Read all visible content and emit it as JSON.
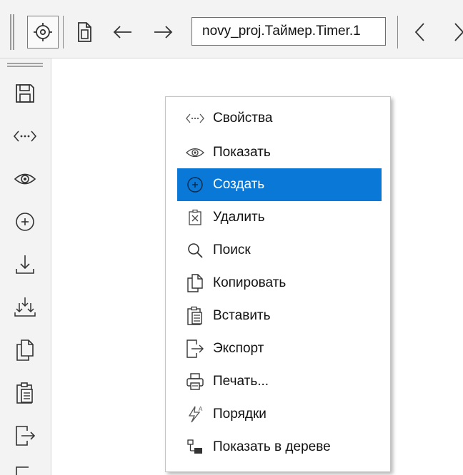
{
  "toolbar": {
    "path_value": "novy_proj.Таймер.Timer.1",
    "buttons": [
      {
        "name": "locate-icon"
      },
      {
        "name": "document-icon"
      },
      {
        "name": "back-arrow-icon"
      },
      {
        "name": "forward-arrow-icon"
      },
      {
        "name": "chevron-left-icon"
      },
      {
        "name": "chevron-right-icon"
      }
    ]
  },
  "left_bar": {
    "buttons": [
      {
        "name": "save-icon"
      },
      {
        "name": "properties-icon"
      },
      {
        "name": "show-icon"
      },
      {
        "name": "create-icon"
      },
      {
        "name": "download-icon"
      },
      {
        "name": "merge-download-icon"
      },
      {
        "name": "copy-icon"
      },
      {
        "name": "paste-icon"
      },
      {
        "name": "export-icon"
      },
      {
        "name": "more-icon"
      }
    ]
  },
  "context_menu": {
    "highlight_color": "#0a78d7",
    "items": [
      {
        "label": "Свойства",
        "icon": "properties-icon"
      },
      {
        "label": "Показать",
        "icon": "eye-icon"
      },
      {
        "label": "Создать",
        "icon": "create-icon",
        "highlighted": true
      },
      {
        "label": "Удалить",
        "icon": "delete-icon"
      },
      {
        "label": "Поиск",
        "icon": "search-icon"
      },
      {
        "label": "Копировать",
        "icon": "copy-icon"
      },
      {
        "label": "Вставить",
        "icon": "paste-icon"
      },
      {
        "label": "Экспорт",
        "icon": "export-icon"
      },
      {
        "label": "Печать...",
        "icon": "print-icon"
      },
      {
        "label": "Порядки",
        "icon": "orders-icon"
      },
      {
        "label": "Показать в дереве",
        "icon": "tree-icon"
      }
    ]
  }
}
